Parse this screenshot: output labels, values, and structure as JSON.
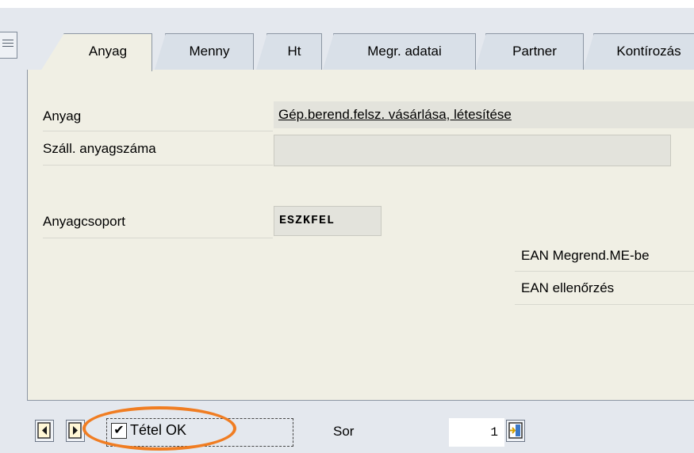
{
  "tabs": [
    {
      "label": "Anyag",
      "active": true
    },
    {
      "label": "Menny",
      "active": false
    },
    {
      "label": "Ht",
      "active": false
    },
    {
      "label": "Megr. adatai",
      "active": false
    },
    {
      "label": "Partner",
      "active": false
    },
    {
      "label": "Kontírozás",
      "active": false
    }
  ],
  "form": {
    "anyag_label": "Anyag",
    "anyag_value": "Gép.berend.felsz. vásárlása, létesítése",
    "szall_label": "Száll. anyagszáma",
    "szall_value": "",
    "anyagcsoport_label": "Anyagcsoport",
    "anyagcsoport_value": "ESZKFEL",
    "ean_megrend_label": "EAN Megrend.ME-be",
    "ean_ellenorzes_label": "EAN ellenőrzés"
  },
  "bottom": {
    "item_ok_label": "Tétel OK",
    "item_ok_checked": true,
    "checkmark": "✔",
    "sor_label": "Sor",
    "sor_value": "1"
  },
  "icons": [
    "tab-list-icon",
    "previous-item-icon",
    "next-item-icon",
    "item-selection-icon"
  ],
  "colors": {
    "panel": "#f0efe4",
    "tab": "#d9e0e8",
    "highlight": "#f07d22"
  }
}
